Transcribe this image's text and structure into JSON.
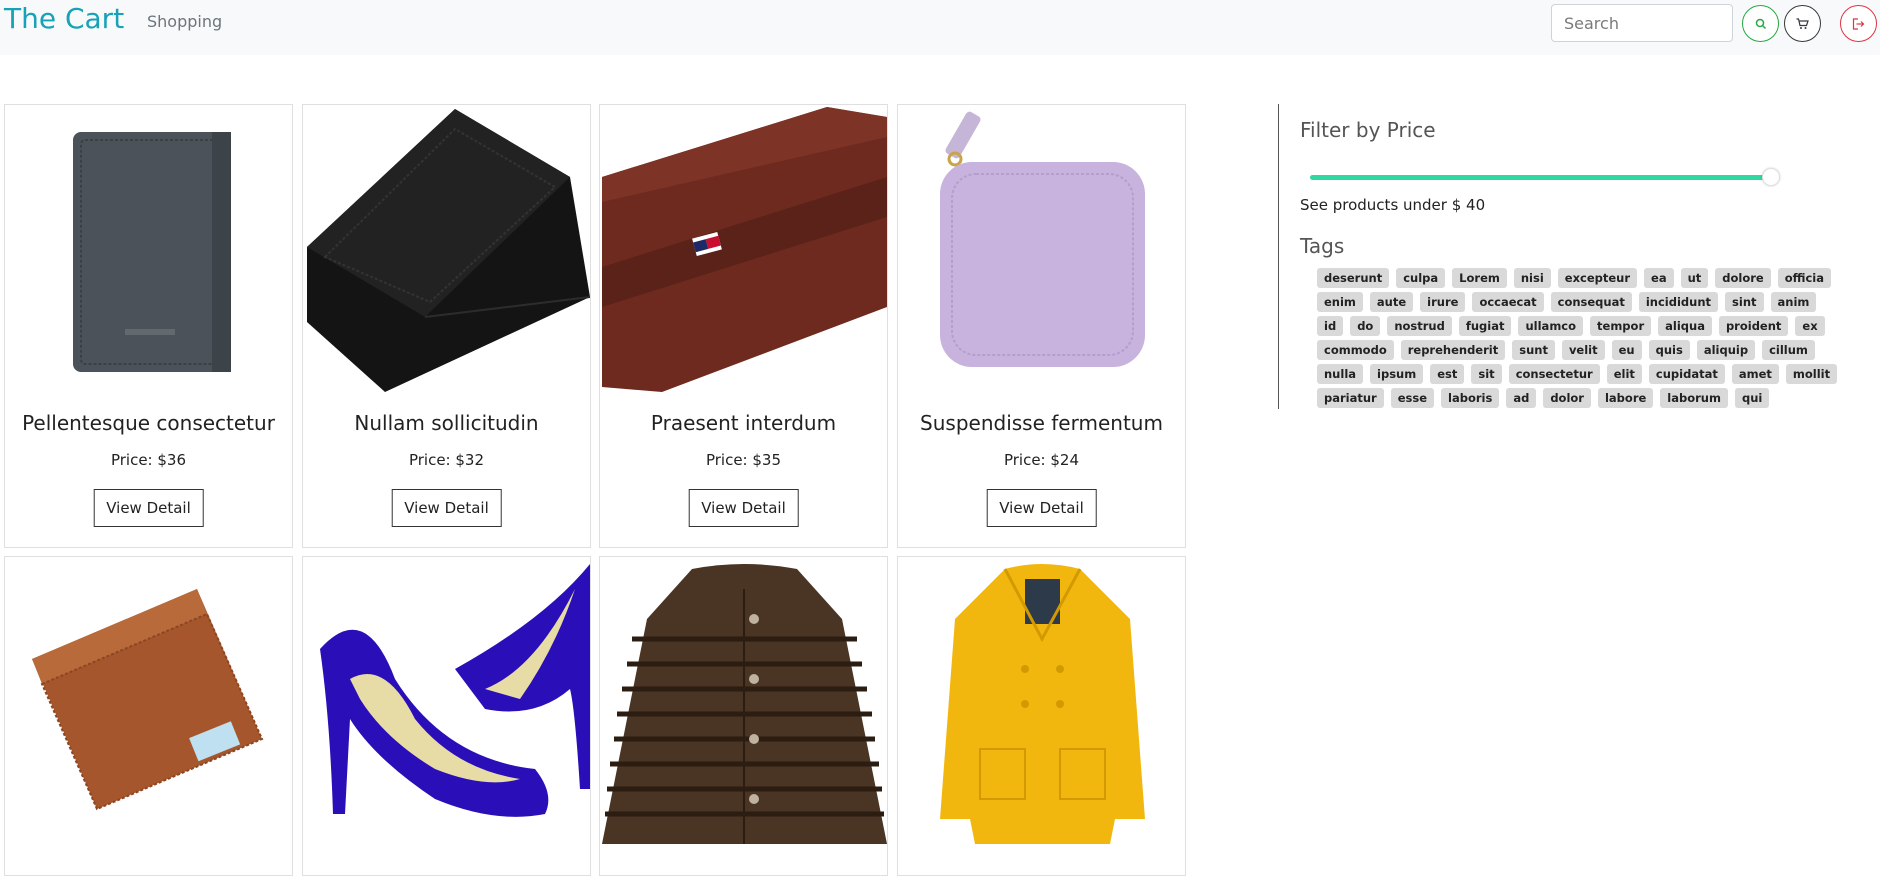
{
  "navbar": {
    "brand": "The Cart",
    "nav_link": "Shopping",
    "search_placeholder": "Search",
    "colors": {
      "brand": "#17a2b8",
      "search_btn": "#28a745",
      "cart_btn": "#343a40",
      "logout_btn": "#dc3545"
    }
  },
  "products": [
    {
      "title": "Pellentesque consectetur",
      "price": "Price: $36",
      "button": "View Detail",
      "image": "gray-bifold-wallet"
    },
    {
      "title": "Nullam sollicitudin",
      "price": "Price: $32",
      "button": "View Detail",
      "image": "black-bifold-wallet"
    },
    {
      "title": "Praesent interdum",
      "price": "Price: $35",
      "button": "View Detail",
      "image": "brown-leather-wallet"
    },
    {
      "title": "Suspendisse fermentum",
      "price": "Price: $24",
      "button": "View Detail",
      "image": "lilac-zip-wallet"
    },
    {
      "image": "tan-leather-wallet"
    },
    {
      "image": "blue-high-heel-shoes"
    },
    {
      "image": "brown-fur-coat"
    },
    {
      "image": "yellow-trench-coat"
    }
  ],
  "sidebar": {
    "filter_title": "Filter by Price",
    "price_slider_value": 40,
    "see_products": "See products under $ 40",
    "tags_title": "Tags",
    "slider_color": "#2ed8a0",
    "tags": [
      "deserunt",
      "culpa",
      "Lorem",
      "nisi",
      "excepteur",
      "ea",
      "ut",
      "dolore",
      "officia",
      "enim",
      "aute",
      "irure",
      "occaecat",
      "consequat",
      "incididunt",
      "sint",
      "anim",
      "id",
      "do",
      "nostrud",
      "fugiat",
      "ullamco",
      "tempor",
      "aliqua",
      "proident",
      "ex",
      "commodo",
      "reprehenderit",
      "sunt",
      "velit",
      "eu",
      "quis",
      "aliquip",
      "cillum",
      "nulla",
      "ipsum",
      "est",
      "sit",
      "consectetur",
      "elit",
      "cupidatat",
      "amet",
      "mollit",
      "pariatur",
      "esse",
      "laboris",
      "ad",
      "dolor",
      "labore",
      "laborum",
      "qui"
    ]
  }
}
